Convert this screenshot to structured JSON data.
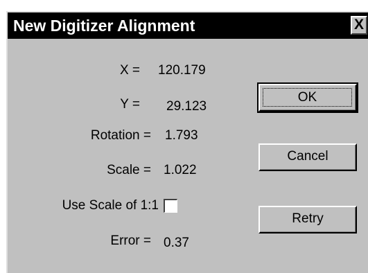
{
  "window": {
    "title": "New Digitizer Alignment",
    "close_label": "X"
  },
  "fields": {
    "x_label": "X =",
    "x_value": "120.179",
    "y_label": "Y =",
    "y_value": "29.123",
    "rotation_label": "Rotation =",
    "rotation_value": "1.793",
    "scale_label": "Scale =",
    "scale_value": "1.022",
    "use_scale_label": "Use Scale of 1:1",
    "use_scale_checked": false,
    "error_label": "Error =",
    "error_value": "0.37"
  },
  "buttons": {
    "ok": "OK",
    "cancel": "Cancel",
    "retry": "Retry"
  },
  "colors": {
    "titlebar": "#000000",
    "dialog_face": "#c0c0c0"
  }
}
